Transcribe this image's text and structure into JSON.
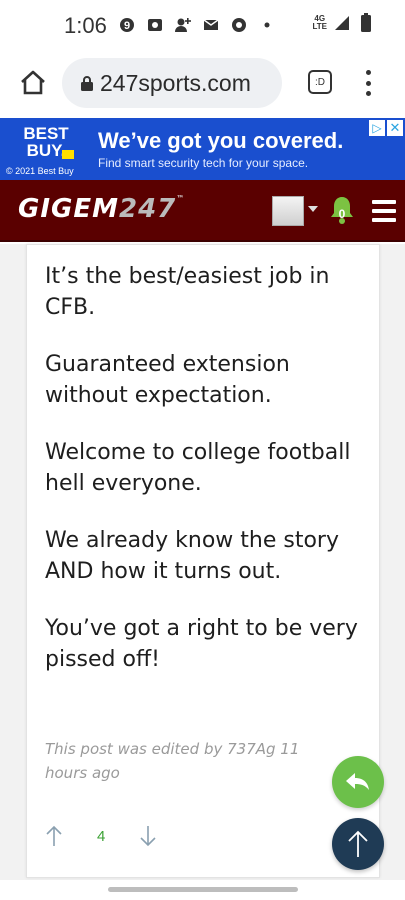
{
  "status_bar": {
    "time": "1:06",
    "network": "4G\nLTE"
  },
  "browser": {
    "url": "247sports.com",
    "tab_count": ":D"
  },
  "ad": {
    "brand_line1": "BEST",
    "brand_line2": "BUY.",
    "copyright": "© 2021 Best Buy",
    "headline": "We’ve got you covered.",
    "subline": "Find smart security tech for your space."
  },
  "site": {
    "logo_text": "GIGEM",
    "logo_num": "247",
    "logo_tm": "™",
    "notification_count": "0"
  },
  "post": {
    "paragraphs": [
      "It’s the best/easiest job in CFB.",
      "Guaranteed extension without expectation.",
      "Welcome to college football hell everyone.",
      "We already know the story AND how it turns out.",
      "You’ve got a right to be very pissed off!"
    ],
    "edited_note": "This post was edited by 737Ag 11 hours ago",
    "vote_count": "4"
  },
  "colors": {
    "header_maroon": "#5a0000",
    "ad_blue": "#1a4fcf",
    "reply_green": "#6cc04a",
    "top_navy": "#1f3b55",
    "vote_green": "#3ca235"
  }
}
